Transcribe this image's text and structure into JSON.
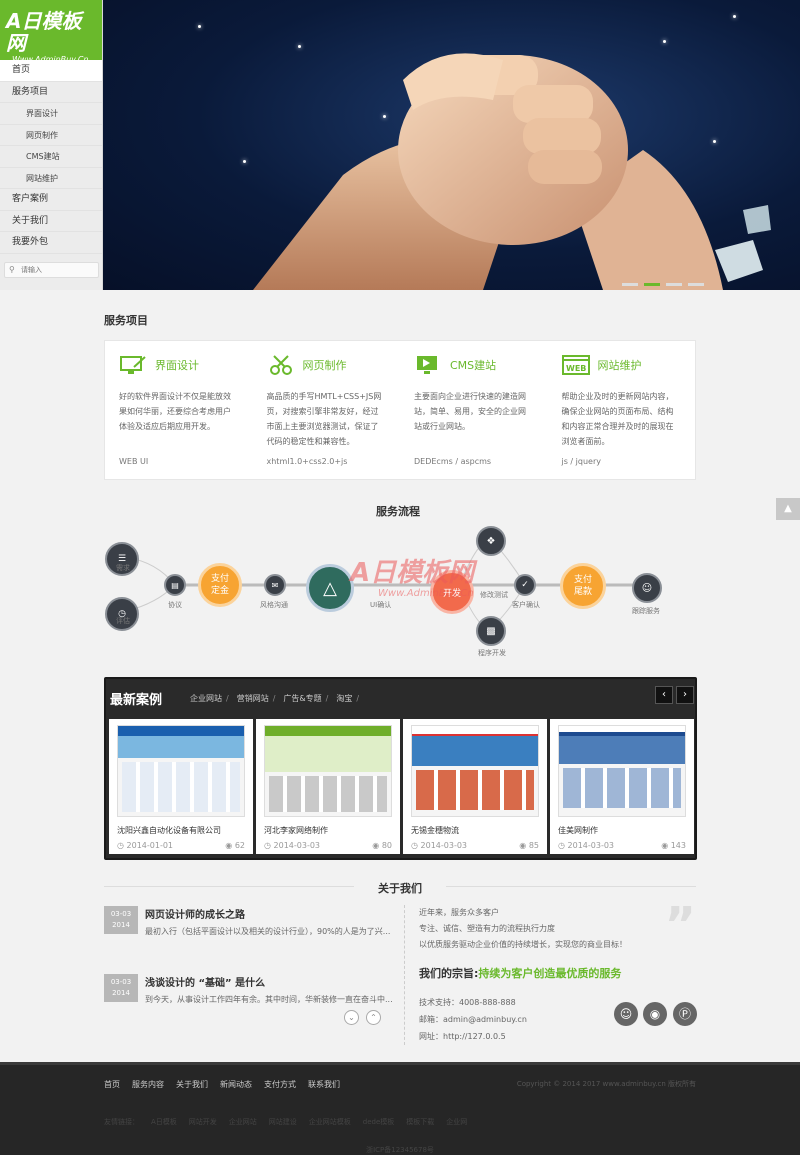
{
  "logo": {
    "main": "A日模板网",
    "sub": "Www.AdminBuy.Cn"
  },
  "sidebar": {
    "items": [
      {
        "label": "首页",
        "type": "main",
        "active": true
      },
      {
        "label": "服务项目",
        "type": "main"
      },
      {
        "label": "界面设计",
        "type": "sub"
      },
      {
        "label": "网页制作",
        "type": "sub"
      },
      {
        "label": "CMS建站",
        "type": "sub"
      },
      {
        "label": "网站维护",
        "type": "sub"
      },
      {
        "label": "客户案例",
        "type": "main"
      },
      {
        "label": "关于我们",
        "type": "main"
      },
      {
        "label": "我要外包",
        "type": "main"
      }
    ],
    "search_placeholder": "请输入"
  },
  "services": {
    "title": "服务项目",
    "items": [
      {
        "name": "界面设计",
        "icon": "monitor-brush-icon",
        "desc": "好的软件界面设计不仅是能放效果如何华丽，还要综合考虑用户体验及适应后期应用开发。",
        "tech": "WEB UI"
      },
      {
        "name": "网页制作",
        "icon": "scissors-icon",
        "desc": "高品质的手写HMTL+CSS+JS网页，对搜索引擎非常友好，经过市面上主要浏览器测试，保证了代码的稳定性和兼容性。",
        "tech": "xhtml1.0+css2.0+js"
      },
      {
        "name": "CMS建站",
        "icon": "cms-screen-icon",
        "desc": "主要面向企业进行快速的建造网站，简单、易用，安全的企业网站或行业网站。",
        "tech": "DEDEcms / aspcms"
      },
      {
        "name": "网站维护",
        "icon": "web-window-icon",
        "desc": "帮助企业及时的更新网站内容，确保企业网站的页面布局、结构和内容正常合理并及时的展现在浏览者面前。",
        "tech": "js / jquery"
      }
    ]
  },
  "process": {
    "title": "服务流程",
    "steps": {
      "demand": "需求",
      "evaluate": "评估",
      "agreement": "协议",
      "pay_deposit": "支付\n定金",
      "style_confirm": "风格沟通",
      "dev": "开发",
      "ui_confirm": "UI确认",
      "test": "修改测试",
      "program": "程序开发",
      "customer_confirm": "客户确认",
      "pay_final": "支付\n尾款",
      "followup": "跟踪服务"
    }
  },
  "cases": {
    "title": "最新案例",
    "tabs": [
      "企业网站",
      "营销网站",
      "广告&专题",
      "淘宝"
    ],
    "items": [
      {
        "name": "沈阳兴鑫自动化设备有限公司",
        "date": "2014-01-01",
        "views": "62"
      },
      {
        "name": "河北李家网络制作",
        "date": "2014-03-03",
        "views": "80"
      },
      {
        "name": "无锡金穗物流",
        "date": "2014-03-03",
        "views": "85"
      },
      {
        "name": "佳美网制作",
        "date": "2014-03-03",
        "views": "143"
      }
    ]
  },
  "about": {
    "title": "关于我们",
    "news": [
      {
        "date_top": "03-03",
        "date_bot": "2014",
        "title": "网页设计师的成长之路",
        "desc": "最初入行（包括平面设计以及相关的设计行业），90%的人是为了兴..."
      },
      {
        "date_top": "03-03",
        "date_bot": "2014",
        "title": "浅谈设计的 “基础” 是什么",
        "desc": "到今天，从事设计工作四年有余。其中时间，华新装修一直在奋斗中..."
      }
    ],
    "intro": [
      "近年来，服务众多客户",
      "专注、诚信、塑造有力的流程执行力度",
      "以优质服务驱动企业价值的持续增长，实现您的商业目标！"
    ],
    "slogan_prefix": "我们的宗旨:",
    "slogan_highlight": "持续为客户创造最优质的服务",
    "support": "技术支持：4008-888-888",
    "email": "邮箱：admin@adminbuy.cn",
    "site": "网址：http://127.0.0.5"
  },
  "footer": {
    "nav": [
      "首页",
      "服务内容",
      "关于我们",
      "新闻动态",
      "支付方式",
      "联系我们"
    ],
    "copyright": "Copyright © 2014 2017 www.adminbuy.cn 版权所有",
    "links_label": "友情链接：",
    "links": [
      "A日模板",
      "网站开发",
      "企业网站",
      "网站建设",
      "企业网站模板",
      "dede模板",
      "模板下载",
      "企业网"
    ],
    "icp": "浙ICP备12345678号"
  },
  "watermark": {
    "main": "A日模板网",
    "sub": "Www.AdminBuy.Cn"
  },
  "colors": {
    "brand_green": "#6ab92c",
    "orange": "#f7a432",
    "dark_node": "#3a3f47",
    "footer_bg": "#262626"
  }
}
